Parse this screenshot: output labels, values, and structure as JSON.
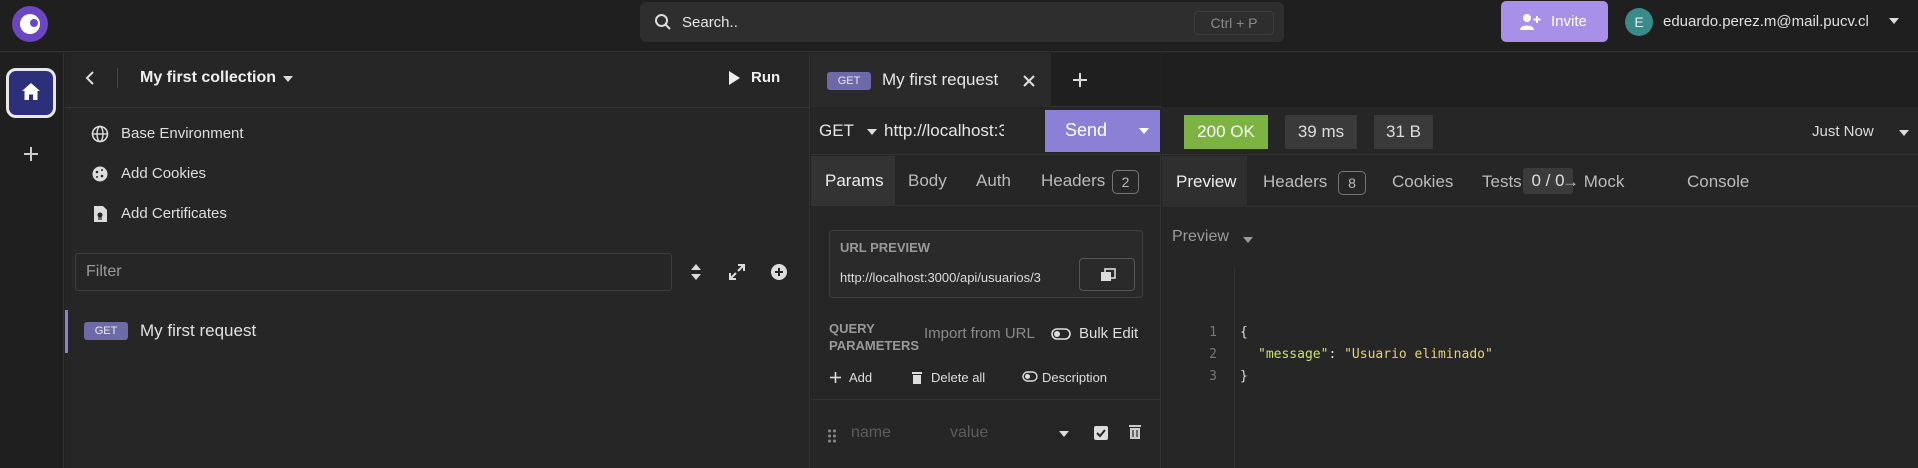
{
  "topbar": {
    "logo_icon": "insomnia-logo-icon",
    "search_label": "Search..",
    "search_shortcut": "Ctrl + P",
    "invite_label": "Invite",
    "user_initial": "E",
    "user_email": "eduardo.perez.m@mail.pucv.cl"
  },
  "collection": {
    "title": "My first collection",
    "run_label": "Run",
    "menu": [
      {
        "label": "Base Environment",
        "icon": "globe-icon"
      },
      {
        "label": "Add Cookies",
        "icon": "cookie-icon"
      },
      {
        "label": "Add Certificates",
        "icon": "certificate-icon"
      }
    ],
    "filter_placeholder": "Filter",
    "requests": [
      {
        "method": "GET",
        "name": "My first request"
      }
    ]
  },
  "request": {
    "tab_method": "GET",
    "tab_name": "My first request",
    "method": "GET",
    "url": "http://localhost:3000/api/usuarios/3",
    "send_label": "Send",
    "tabs": {
      "params": "Params",
      "body": "Body",
      "auth": "Auth",
      "headers": "Headers",
      "headers_count": "2"
    },
    "url_preview_title": "URL PREVIEW",
    "url_preview": "http://localhost:3000/api/usuarios/3",
    "query_params_title_1": "QUERY",
    "query_params_title_2": "PARAMETERS",
    "import_from_url": "Import from URL",
    "bulk_edit": "Bulk Edit",
    "add_label": "Add",
    "delete_all_label": "Delete all",
    "description_label": "Description",
    "name_placeholder": "name",
    "value_placeholder": "value"
  },
  "response": {
    "status": "200 OK",
    "time": "39 ms",
    "size": "31 B",
    "timestamp": "Just Now",
    "tabs": {
      "preview": "Preview",
      "headers": "Headers",
      "headers_count": "8",
      "cookies": "Cookies",
      "tests": "Tests",
      "tests_count": "0 / 0",
      "mock": "→ Mock",
      "console": "Console"
    },
    "preview_mode": "Preview",
    "body_lines": [
      "1",
      "2",
      "3"
    ],
    "json_open": "{",
    "json_key": "\"message\"",
    "json_colon": ": ",
    "json_value": "\"Usuario eliminado\"",
    "json_close": "}"
  },
  "colors": {
    "accent": "#8b7fd6",
    "status_ok": "#7cb342",
    "background": "#232323"
  }
}
